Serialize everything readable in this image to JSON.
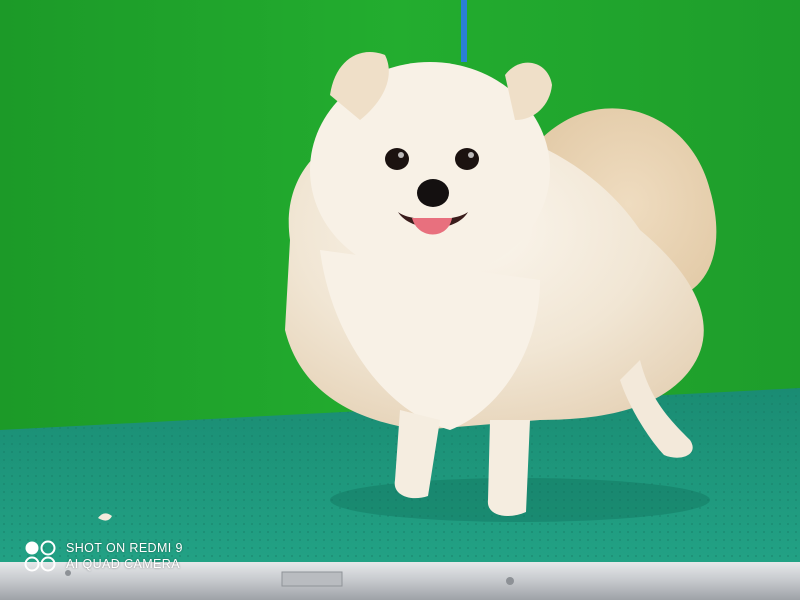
{
  "photo": {
    "subject_icon": "pomeranian-dog-icon",
    "colors": {
      "backdrop_green": "#1fa22a",
      "mat_teal": "#1f9a80",
      "fur_cream": "#f4ebdc",
      "table_edge_silver": "#c9ccd0",
      "leash_blue": "#2a7fd8"
    }
  },
  "watermark": {
    "icon": "camera-lens-logo-icon",
    "line1": "SHOT ON REDMI 9",
    "line2": "AI QUAD CAMERA"
  }
}
